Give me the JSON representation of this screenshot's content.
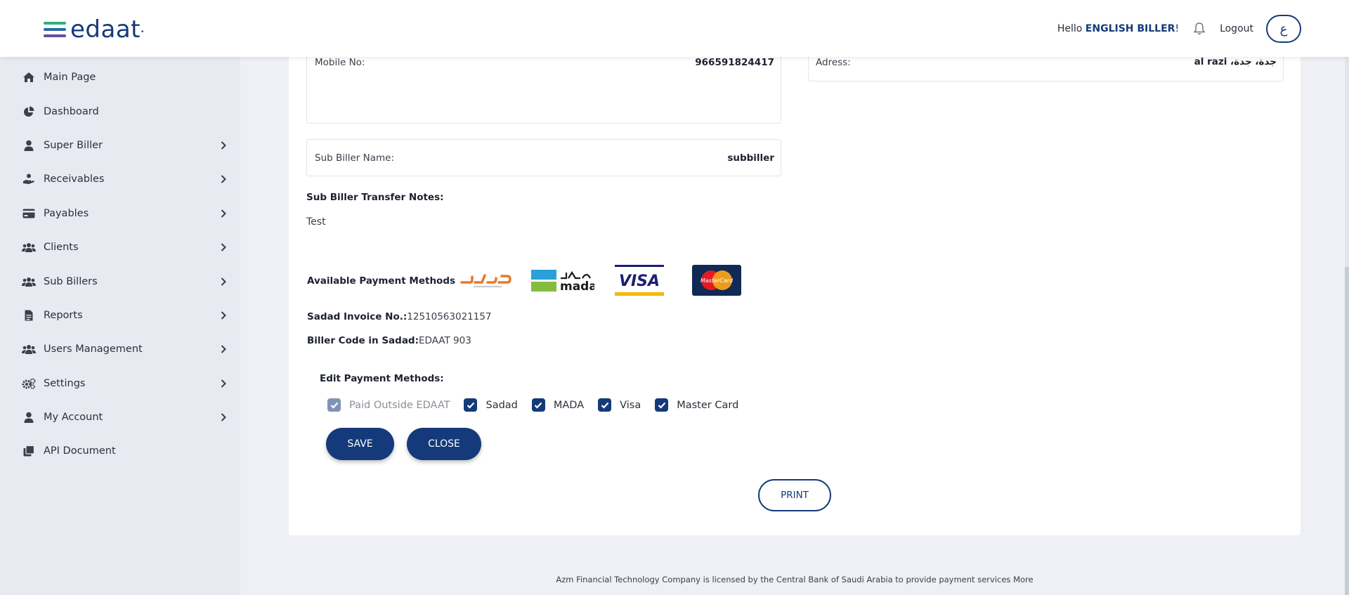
{
  "header": {
    "logo_text": "edaat",
    "greeting": "Hello",
    "user_name": "ENGLISH BILLER",
    "greeting_suffix": "!",
    "logout_label": "Logout",
    "language_toggle": "ع"
  },
  "sidebar": {
    "items": [
      {
        "label": "Main Page",
        "icon": "home-icon",
        "has_submenu": false
      },
      {
        "label": "Dashboard",
        "icon": "pie-chart-icon",
        "has_submenu": false
      },
      {
        "label": "Super Biller",
        "icon": "user-icon",
        "has_submenu": true
      },
      {
        "label": "Receivables",
        "icon": "hand-coin-icon",
        "has_submenu": true
      },
      {
        "label": "Payables",
        "icon": "credit-card-icon",
        "has_submenu": true
      },
      {
        "label": "Clients",
        "icon": "users-icon",
        "has_submenu": true
      },
      {
        "label": "Sub Billers",
        "icon": "users-icon",
        "has_submenu": true
      },
      {
        "label": "Reports",
        "icon": "report-icon",
        "has_submenu": true
      },
      {
        "label": "Users Management",
        "icon": "users-icon",
        "has_submenu": true
      },
      {
        "label": "Settings",
        "icon": "gears-icon",
        "has_submenu": true
      },
      {
        "label": "My Account",
        "icon": "user-icon",
        "has_submenu": true
      },
      {
        "label": "API Document",
        "icon": "documents-icon",
        "has_submenu": false
      }
    ]
  },
  "details": {
    "mobile_label": "Mobile No:",
    "mobile_value": "966591824417",
    "address_label": "Adress:",
    "address_value": "al razi ،جدة، جدة",
    "sub_biller_name_label": "Sub Biller Name:",
    "sub_biller_name_value": "subbiller",
    "transfer_notes_label": "Sub Biller Transfer Notes:",
    "transfer_notes_value": "Test"
  },
  "payment": {
    "available_label": "Available Payment Methods",
    "logos": [
      "sadad",
      "mada",
      "visa",
      "mastercard"
    ],
    "sadad_invoice_label": "Sadad Invoice No.:",
    "sadad_invoice_value": "12510563021157",
    "biller_code_label": "Biller Code in Sadad:",
    "biller_code_value": "EDAAT 903",
    "edit_label": "Edit Payment Methods:",
    "options": [
      {
        "label": "Paid Outside EDAAT",
        "checked": true,
        "disabled": true
      },
      {
        "label": "Sadad",
        "checked": true,
        "disabled": false
      },
      {
        "label": "MADA",
        "checked": true,
        "disabled": false
      },
      {
        "label": "Visa",
        "checked": true,
        "disabled": false
      },
      {
        "label": "Master Card",
        "checked": true,
        "disabled": false
      }
    ],
    "save_label": "SAVE",
    "close_label": "CLOSE"
  },
  "print_label": "PRINT",
  "footer": {
    "text": "Azm Financial Technology Company is licensed by the Central Bank of Saudi Arabia to provide payment services",
    "more_label": "More"
  },
  "colors": {
    "primary": "#143a7b",
    "sidebar_bg": "#e7eaf1",
    "page_bg": "#eef0f5"
  }
}
